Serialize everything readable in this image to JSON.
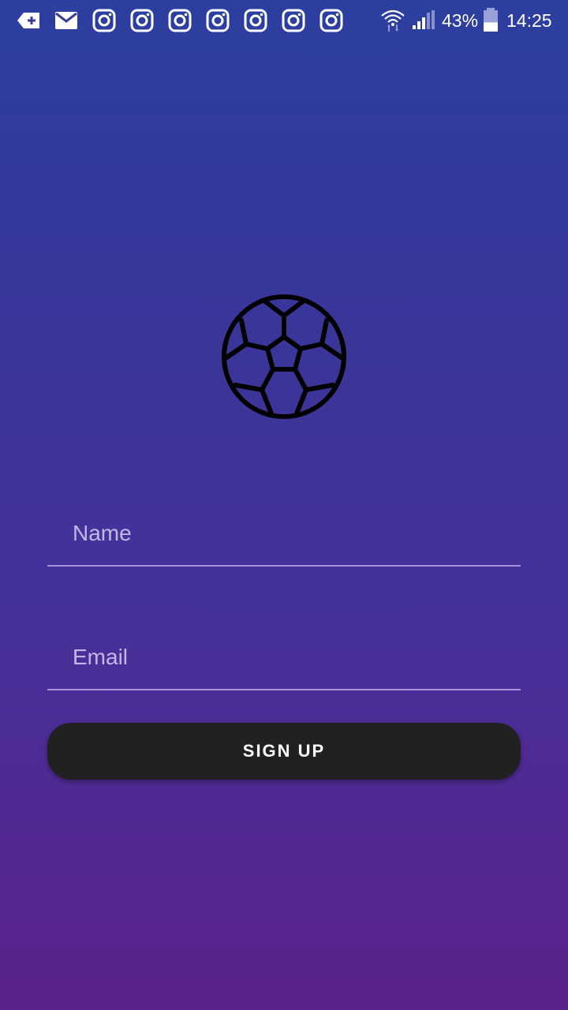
{
  "status_bar": {
    "icons_left": [
      "sim-add-icon",
      "mail-icon",
      "instagram-icon",
      "instagram-icon",
      "instagram-icon",
      "instagram-icon",
      "instagram-icon",
      "instagram-icon",
      "instagram-icon"
    ],
    "icons_right": [
      "wifi-icon",
      "signal-icon",
      "battery-icon"
    ],
    "battery_percent": "43%",
    "battery_level": 0.43,
    "time": "14:25"
  },
  "logo": {
    "icon": "soccer-ball-icon"
  },
  "form": {
    "name_placeholder": "Name",
    "email_placeholder": "Email",
    "signup_label": "SIGN UP"
  },
  "colors": {
    "gradient_top": "#2c3f9f",
    "gradient_bottom": "#5a228a",
    "button_bg": "#212121"
  }
}
